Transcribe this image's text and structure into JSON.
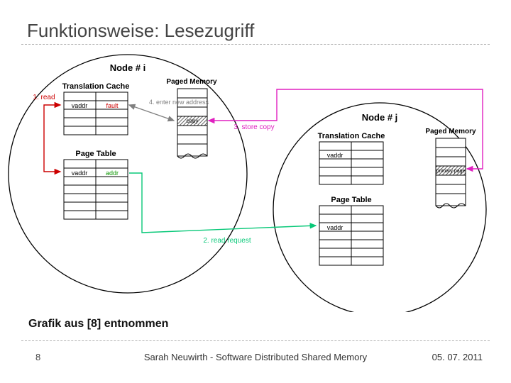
{
  "title": "Funktionsweise: Lesezugriff",
  "caption": "Grafik aus [8] entnommen",
  "footer": {
    "page": "8",
    "author": "Sarah Neuwirth - Software Distributed Shared Memory",
    "date": "05. 07. 2011"
  },
  "diagram": {
    "nodes": [
      {
        "id": "i",
        "title": "Node # i",
        "tc_title": "Translation Cache",
        "tc_row": {
          "c1": "vaddr",
          "c2": "fault",
          "c2_color": "#c00"
        },
        "pt_title": "Page Table",
        "pt_row": {
          "c1": "vaddr",
          "c2": "addr",
          "c2_color": "#0b9600"
        },
        "pm_title": "Paged Memory",
        "pm_label": "copy"
      },
      {
        "id": "j",
        "title": "Node # j",
        "tc_title": "Translation Cache",
        "tc_row": {
          "c1": "vaddr",
          "c2": ""
        },
        "pt_title": "Page Table",
        "pt_row": {
          "c1": "vaddr",
          "c2": ""
        },
        "pm_title": "Paged Memory",
        "pm_label": "primary page"
      }
    ],
    "arrows": [
      {
        "label": "1. read",
        "color": "#c00"
      },
      {
        "label": "2. read request",
        "color": "#08c878"
      },
      {
        "label": "3. store copy",
        "color": "#e020c0"
      },
      {
        "label": "4. enter new address",
        "color": "#808080"
      }
    ]
  }
}
